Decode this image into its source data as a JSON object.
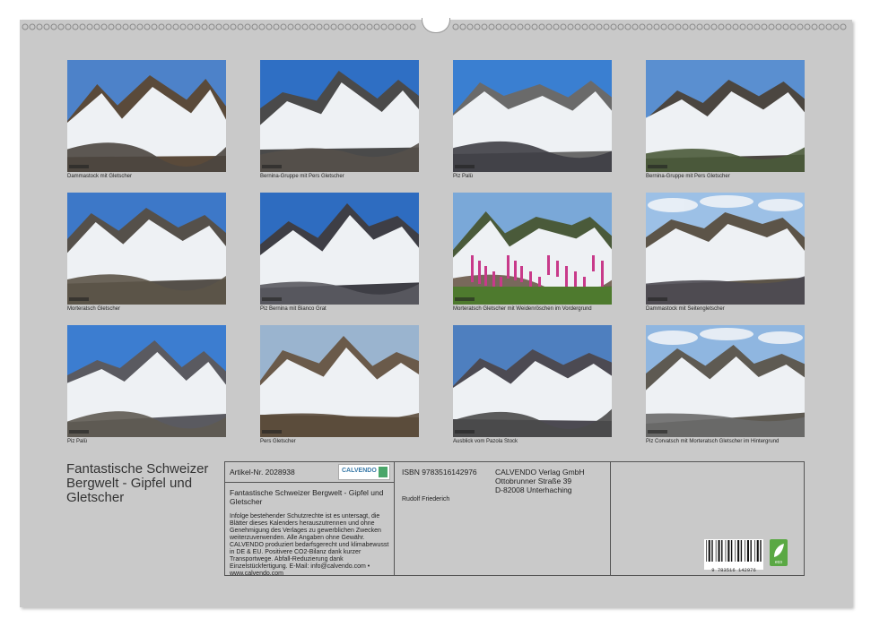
{
  "photos": [
    {
      "caption": "Dammastock mit Gletscher"
    },
    {
      "caption": "Bernina-Gruppe mit Pers Gletscher"
    },
    {
      "caption": "Piz Palü"
    },
    {
      "caption": "Bernina-Gruppe mit Pers Gletscher"
    },
    {
      "caption": "Morteratsch Gletscher"
    },
    {
      "caption": "Piz Bernina mit Bianco Grat"
    },
    {
      "caption": "Morteratsch Gletscher mit Weidenröschen im Vordergrund"
    },
    {
      "caption": "Dammastock mit Seitengletscher"
    },
    {
      "caption": "Piz Palü"
    },
    {
      "caption": "Pers Gletscher"
    },
    {
      "caption": "Ausblick vom Pazola Stock"
    },
    {
      "caption": "Piz Corvatsch mit Morteratsch Gletscher im Hintergrund"
    }
  ],
  "cover_title": "Fantastische Schweizer Bergwelt - Gipfel und Gletscher",
  "info": {
    "article_no": "Artikel-Nr. 2028938",
    "logo_text": "CALVENDO",
    "product_title": "Fantastische Schweizer Bergwelt - Gipfel und Gletscher",
    "legal_text": "Infolge bestehender Schutzrechte ist es untersagt, die Blätter dieses Kalenders herauszutrennen und ohne Genehmigung des Verlages zu gewerblichen Zwecken weiterzuverwenden. Alle Angaben ohne Gewähr. CALVENDO produziert bedarfsgerecht und klimabewusst in DE & EU. Positivere CO2-Bilanz dank kurzer Transportwege. Abfall-Reduzierung dank Einzelstückfertigung. E-Mail: info@calvendo.com • www.calvendo.com",
    "isbn": "ISBN 9783516142976",
    "author": "Rudolf Friederich",
    "publisher_name": "CALVENDO Verlag GmbH",
    "publisher_street": "Ottobrunner Straße 39",
    "publisher_city": "D-82008 Unterhaching",
    "barcode_number": "9 783516 142976"
  }
}
